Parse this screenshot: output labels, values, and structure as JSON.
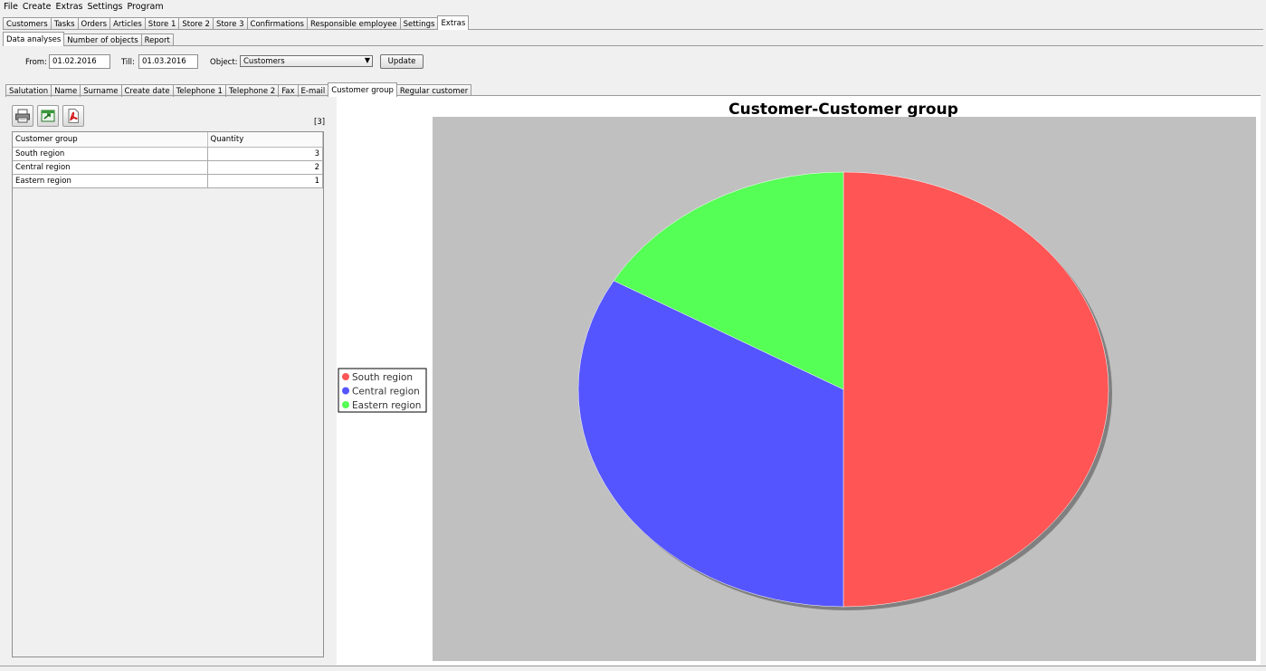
{
  "menu": [
    "File",
    "Create",
    "Extras",
    "Settings",
    "Program"
  ],
  "main_tabs": [
    "Customers",
    "Tasks",
    "Orders",
    "Articles",
    "Store 1",
    "Store 2",
    "Store 3",
    "Confirmations",
    "Responsible employee",
    "Settings",
    "Extras"
  ],
  "main_tab_active": "Extras",
  "sub_tabs": [
    "Data analyses",
    "Number of objects",
    "Report"
  ],
  "sub_tab_active": "Data analyses",
  "filter": {
    "from_label": "From:",
    "from_value": "01.02.2016",
    "till_label": "Till:",
    "till_value": "01.03.2016",
    "object_label": "Object:",
    "object_value": "Customers",
    "update_label": "Update"
  },
  "field_tabs": [
    "Salutation",
    "Name",
    "Surname",
    "Create date",
    "Telephone 1",
    "Telephone 2",
    "Fax",
    "E-mail",
    "Customer group",
    "Regular customer"
  ],
  "field_tab_active": "Customer group",
  "toolbar": {
    "print_icon": "printer-icon",
    "export_icon": "export-icon",
    "pdf_icon": "pdf-icon",
    "count": "[3]"
  },
  "table": {
    "columns": [
      "Customer group",
      "Quantity"
    ],
    "rows": [
      [
        "South region",
        "3"
      ],
      [
        "Central region",
        "2"
      ],
      [
        "Eastern region",
        "1"
      ]
    ]
  },
  "chart_data": {
    "type": "pie",
    "title": "Customer-Customer group",
    "categories": [
      "South region",
      "Central region",
      "Eastern region"
    ],
    "values": [
      3,
      2,
      1
    ],
    "colors": [
      "#ff5555",
      "#5555ff",
      "#55ff55"
    ],
    "plot_background": "#c0c0c0",
    "legend_placement": "left"
  }
}
